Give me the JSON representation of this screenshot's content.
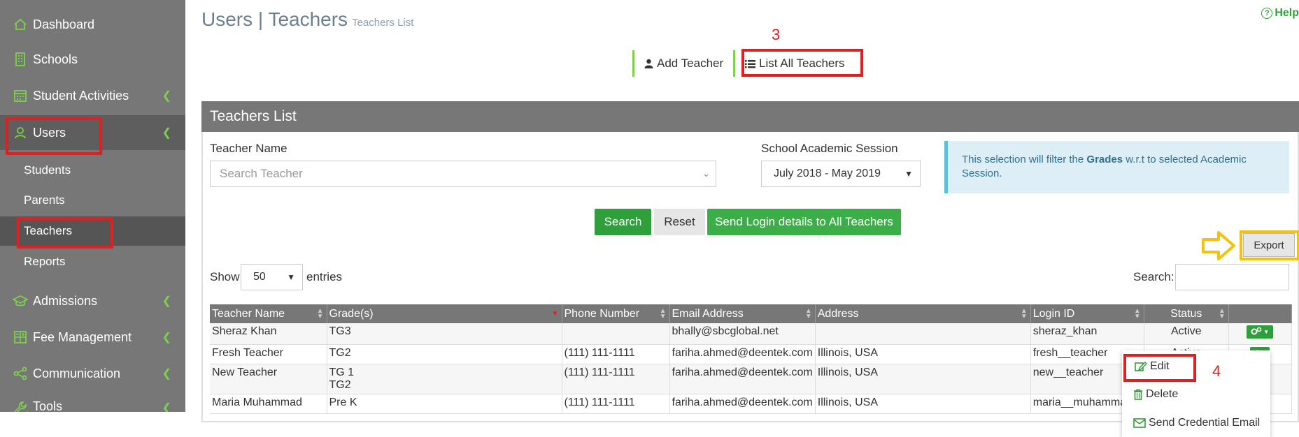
{
  "sidebar": {
    "items": [
      {
        "label": "Dashboard"
      },
      {
        "label": "Schools"
      },
      {
        "label": "Student Activities"
      },
      {
        "label": "Users"
      },
      {
        "label": "Admissions"
      },
      {
        "label": "Fee Management"
      },
      {
        "label": "Communication"
      },
      {
        "label": "Tools"
      }
    ],
    "subitems": [
      {
        "label": "Students"
      },
      {
        "label": "Parents"
      },
      {
        "label": "Teachers"
      },
      {
        "label": "Reports"
      }
    ]
  },
  "header": {
    "title": "Users | Teachers",
    "subtitle": "Teachers List",
    "help": "Help"
  },
  "annotations": {
    "step3": "3",
    "step4": "4"
  },
  "tabs": {
    "add": "Add Teacher",
    "list": "List All Teachers"
  },
  "panel": {
    "title": "Teachers List",
    "teacher_name_label": "Teacher Name",
    "search_teacher_placeholder": "Search Teacher",
    "session_label": "School Academic Session",
    "session_value": "July 2018 - May 2019",
    "info_pre": "This selection will filter the ",
    "info_bold": "Grades",
    "info_post": " w.r.t to selected Academic Session.",
    "search_btn": "Search",
    "reset_btn": "Reset",
    "send_btn": "Send Login details to All Teachers",
    "export_btn": "Export",
    "show_label": "Show",
    "entries_value": "50",
    "entries_label": "entries",
    "search_label": "Search:"
  },
  "table": {
    "headers": [
      "Teacher Name",
      "Grade(s)",
      "Phone Number",
      "Email Address",
      "Address",
      "Login ID",
      "Status"
    ],
    "rows": [
      {
        "name": "Sheraz Khan",
        "grade": "TG3",
        "grade2": "",
        "phone": "",
        "email": "bhally@sbcglobal.net",
        "address": "",
        "login": "sheraz_khan",
        "status": "Active"
      },
      {
        "name": "Fresh Teacher",
        "grade": "TG2",
        "grade2": "",
        "phone": "(111) 111-1111",
        "email": "fariha.ahmed@deentek.com",
        "address": "Illinois, USA",
        "login": "fresh__teacher",
        "status": "Active"
      },
      {
        "name": "New Teacher",
        "grade": "TG 1",
        "grade2": "TG2",
        "phone": "(111) 111-1111",
        "email": "fariha.ahmed@deentek.com",
        "address": "Illinois, USA",
        "login": "new__teacher",
        "status": ""
      },
      {
        "name": "Maria Muhammad",
        "grade": "Pre K",
        "grade2": "",
        "phone": "(111) 111-1111",
        "email": "fariha.ahmed@deentek.com",
        "address": "Illinois, USA",
        "login": "maria__muhammad",
        "status": ""
      }
    ]
  },
  "dropdown": {
    "edit": "Edit",
    "delete": "Delete",
    "send_cred": "Send Credential Email"
  },
  "colors": {
    "sidebar": "#777777",
    "accent_green": "#2e9f3a",
    "highlight_red": "#e02020",
    "highlight_yellow": "#f4c20d"
  }
}
